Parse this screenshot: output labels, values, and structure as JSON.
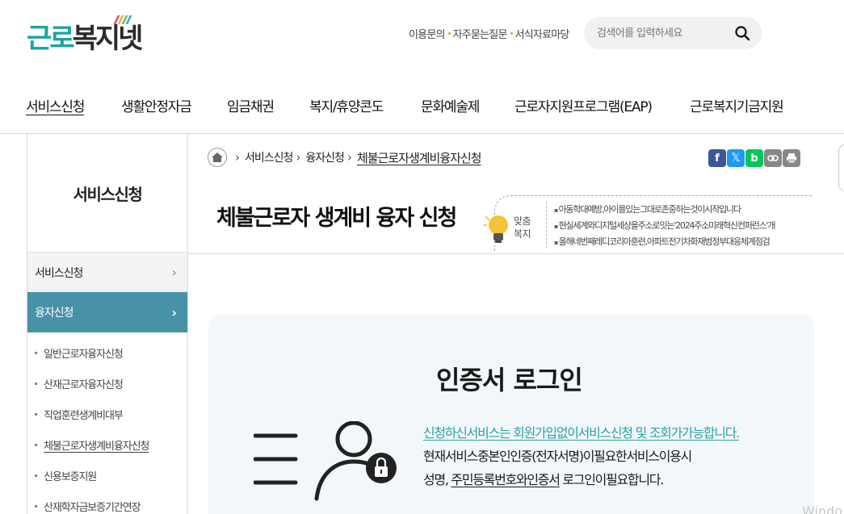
{
  "header": {
    "logo_part1": "근로",
    "logo_part2": "복지넷",
    "logo_stripe_colors": [
      "#e05a7a",
      "#f0b33c",
      "#6cc06c",
      "#4aa8d8"
    ],
    "util_links": [
      "이용문의",
      "자주묻는질문",
      "서식자료마당"
    ],
    "search_placeholder": "검색어를 입력하세요",
    "search_icon": "search-icon"
  },
  "gnb": {
    "items": [
      "서비스신청",
      "생활안정자금",
      "임금채권",
      "복지/휴양콘도",
      "문화예술제",
      "근로자지원프로그램(EAP)",
      "근로복지기금지원"
    ],
    "active_index": 0
  },
  "lnb": {
    "title": "서비스신청",
    "items": [
      {
        "label": "서비스신청",
        "state": "default"
      },
      {
        "label": "융자신청",
        "state": "expanded"
      }
    ],
    "sub_items": [
      "일반근로자융자신청",
      "산재근로자융자신청",
      "직업훈련생계비대부",
      "체불근로자생계비융자신청",
      "신용보증지원",
      "산재학자금보증기간연장"
    ],
    "active_sub_index": 3
  },
  "breadcrumb": {
    "items": [
      "서비스신청",
      "융자신청",
      "체불근로자생계비융자신청"
    ]
  },
  "share_icons": [
    "facebook-icon",
    "x-icon",
    "blog-icon",
    "link-icon",
    "print-icon"
  ],
  "colors": {
    "teal": "#1aa3a3",
    "lnb_active": "#4892a8",
    "login_bg": "#f2f7fa",
    "facebook": "#3b5998",
    "twitter": "#1d9bf0",
    "blog": "#03c75a"
  },
  "page_title": "체불근로자 생계비 융자 신청",
  "tip": {
    "label_line1": "맞춤",
    "label_line2": "복지",
    "items": [
      "아동학대예방,아이를있는그대로존중하는것이시작입니다",
      "현실세계와디지털세상을주소로잇는'2024주소미래혁신컨퍼런스'개",
      "올해네번째레디코리아훈련,아파트전기차화재범정부대응체계점검"
    ]
  },
  "login": {
    "title": "인증서 로그인",
    "line1": "신청하신서비스는 회원가입없이서비스신청 및 조회가가능합니다.",
    "line2": "현재서비스중본인인증(전자서명)이필요한서비스이용시",
    "line3_a": "성명, ",
    "line3_b": "주민등록번호와인증서",
    "line3_c": " 로그인이필요합니다."
  },
  "watermark": "Windo"
}
